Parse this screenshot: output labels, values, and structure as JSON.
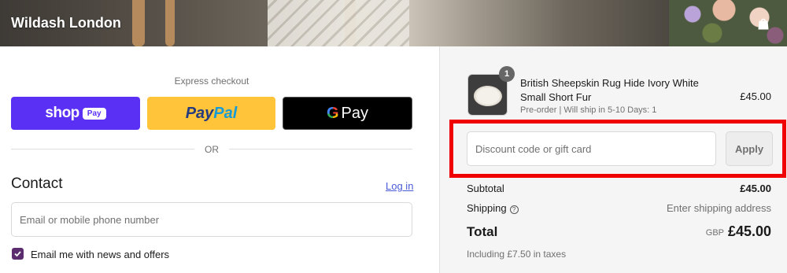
{
  "header": {
    "brand": "Wildash London",
    "icon": "shopping-bag-icon"
  },
  "express": {
    "label": "Express checkout",
    "shop_pay": {
      "word": "shop",
      "pill": "Pay"
    },
    "paypal": {
      "part1": "Pay",
      "part2": "Pal"
    },
    "gpay": {
      "g": "G",
      "pay": "Pay"
    },
    "or": "OR"
  },
  "contact": {
    "heading": "Contact",
    "login": "Log in",
    "email_placeholder": "Email or mobile phone number",
    "newsletter_label": "Email me with news and offers",
    "newsletter_checked": true
  },
  "cart": {
    "item": {
      "quantity": "1",
      "name": "British Sheepskin Rug Hide Ivory White Small Short Fur",
      "variant": "Pre-order | Will ship in 5-10 Days: 1",
      "price": "£45.00"
    },
    "discount_placeholder": "Discount code or gift card",
    "apply_label": "Apply",
    "subtotal_label": "Subtotal",
    "subtotal_value": "£45.00",
    "shipping_label": "Shipping",
    "shipping_value": "Enter shipping address",
    "total_label": "Total",
    "currency": "GBP",
    "total_value": "£45.00",
    "tax_note": "Including £7.50 in taxes"
  },
  "colors": {
    "shop_pay": "#5a31f4",
    "paypal": "#ffc439",
    "gpay": "#000000",
    "checkbox": "#5c2d6e",
    "link": "#4a5bd8",
    "highlight": "#f00000"
  }
}
